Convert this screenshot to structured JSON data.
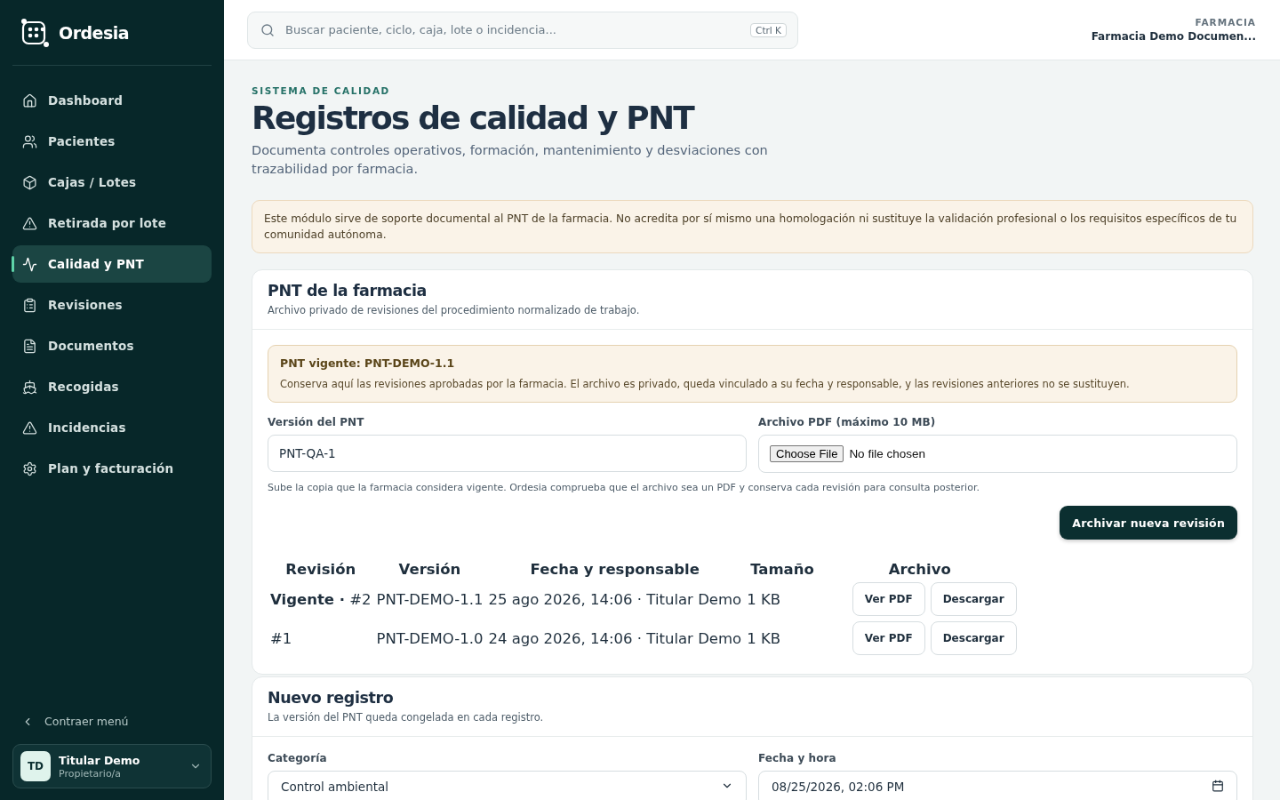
{
  "sidebar": {
    "brand": "Ordesia",
    "items": [
      {
        "label": "Dashboard",
        "selected": false
      },
      {
        "label": "Pacientes",
        "selected": false
      },
      {
        "label": "Cajas / Lotes",
        "selected": false
      },
      {
        "label": "Retirada por lote",
        "selected": false
      },
      {
        "label": "Calidad y PNT",
        "selected": true
      },
      {
        "label": "Revisiones",
        "selected": false
      },
      {
        "label": "Documentos",
        "selected": false
      },
      {
        "label": "Recogidas",
        "selected": false
      },
      {
        "label": "Incidencias",
        "selected": false
      },
      {
        "label": "Plan y facturación",
        "selected": false
      }
    ],
    "collapse": "Contraer menú",
    "user": {
      "initials": "TD",
      "name": "Titular Demo",
      "role": "Propietario/a"
    }
  },
  "header": {
    "search": {
      "placeholder": "Buscar paciente, ciclo, caja, lote o incidencia...",
      "shortcut": "Ctrl K"
    },
    "pharmacy_label": "FARMACIA",
    "pharmacy_name": "Farmacia Demo Documen..."
  },
  "page": {
    "eyebrow": "SISTEMA DE CALIDAD",
    "title": "Registros de calidad y PNT",
    "subtitle": "Documenta controles operativos, formación, mantenimiento y desviaciones con trazabilidad por farmacia.",
    "notice": "Este módulo sirve de soporte documental al PNT de la farmacia. No acredita por sí mismo una homologación ni sustituye la validación profesional o los requisitos específicos de tu comunidad autónoma."
  },
  "pnt_card": {
    "title": "PNT de la farmacia",
    "subtitle": "Archivo privado de revisiones del procedimiento normalizado de trabajo.",
    "current": {
      "title": "PNT vigente: PNT-DEMO-1.1",
      "text": "Conserva aquí las revisiones aprobadas por la farmacia. El archivo es privado, queda vinculado a su fecha y responsable, y las revisiones anteriores no se sustituyen."
    },
    "version_field": {
      "label": "Versión del PNT",
      "value": "PNT-QA-1"
    },
    "file_field": {
      "label": "Archivo PDF (máximo 10 MB)",
      "button": "Choose File",
      "status": "No file chosen"
    },
    "help": "Sube la copia que la farmacia considera vigente. Ordesia comprueba que el archivo sea un PDF y conserva cada revisión para consulta posterior.",
    "submit": "Archivar nueva revisión",
    "table": {
      "columns": [
        "Revisión",
        "Versión",
        "Fecha y responsable",
        "Tamaño",
        "Archivo"
      ],
      "rows": [
        {
          "revision": "**Vigente ·** #2",
          "version": "PNT-DEMO-1.1",
          "date": "25 ago 2026, 14:06 · Titular Demo",
          "size": "1 KB",
          "actions": [
            "Ver PDF",
            "Descargar"
          ]
        },
        {
          "revision": "#1",
          "version": "PNT-DEMO-1.0",
          "date": "24 ago 2026, 14:06 · Titular Demo",
          "size": "1 KB",
          "actions": [
            "Ver PDF",
            "Descargar"
          ]
        }
      ]
    }
  },
  "new_record": {
    "title": "Nuevo registro",
    "subtitle": "La versión del PNT queda congelada en cada registro.",
    "category": {
      "label": "Categoría",
      "value": "Control ambiental"
    },
    "datetime": {
      "label": "Fecha y hora",
      "value": "08/25/2026, 02:06 PM"
    }
  }
}
